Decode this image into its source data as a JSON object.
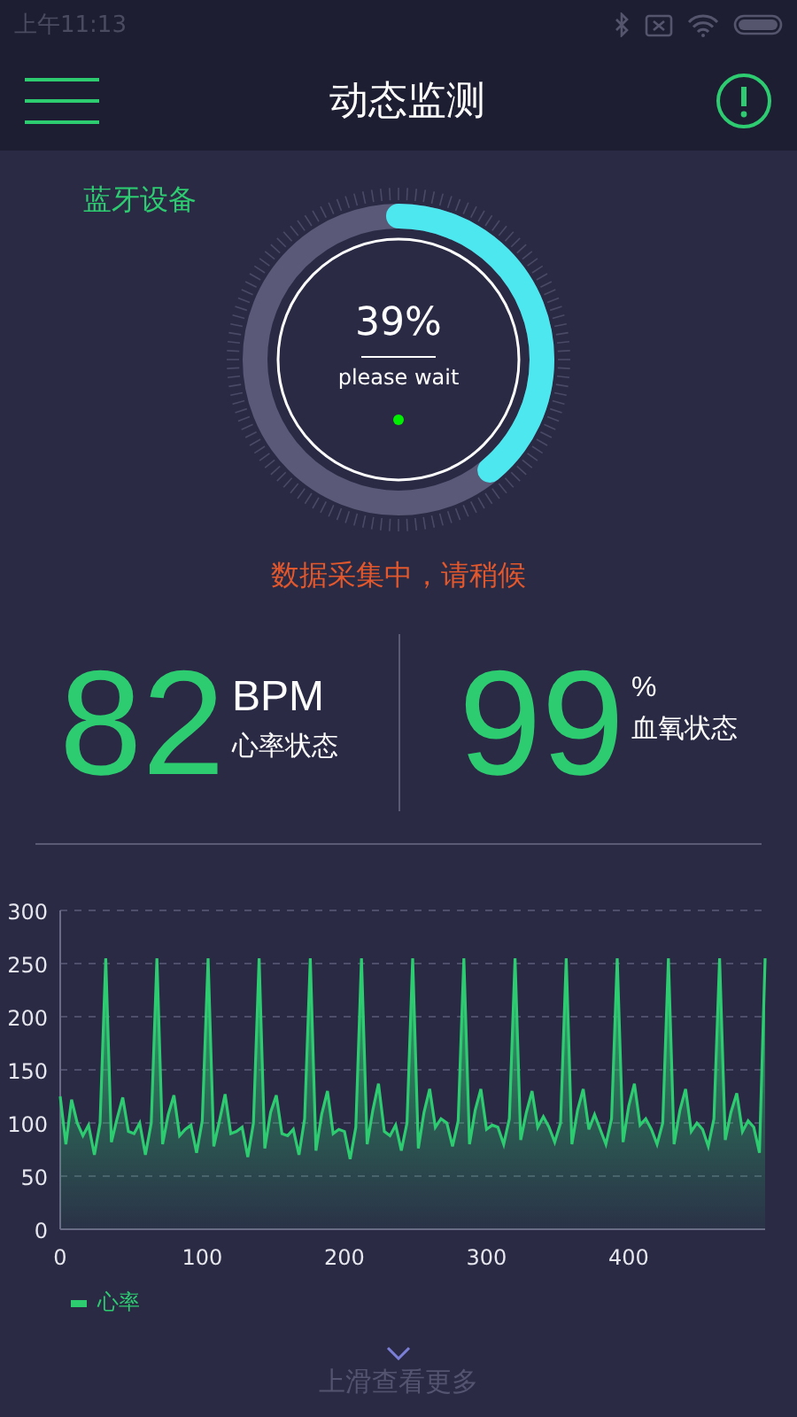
{
  "status_bar": {
    "time": "上午11:13"
  },
  "header": {
    "title": "动态监测"
  },
  "device_label": "蓝牙设备",
  "gauge": {
    "level": 0.39,
    "reading": "39%",
    "caption": "please wait"
  },
  "status_message": "数据采集中，请稍候",
  "metrics": [
    {
      "value": "82",
      "unit": "BPM",
      "label": "心率状态"
    },
    {
      "value": "99",
      "unit": "%",
      "label": "血氧状态"
    }
  ],
  "chart": {
    "chart_data": {
      "type": "area",
      "grid": true,
      "x": [
        0,
        4,
        8,
        12,
        16,
        20,
        24,
        28,
        32,
        36,
        40,
        44,
        48,
        52,
        56,
        60,
        64,
        68,
        72,
        76,
        80,
        84,
        88,
        92,
        96,
        100,
        104,
        108,
        112,
        116,
        120,
        124,
        128,
        132,
        136,
        140,
        144,
        148,
        152,
        156,
        160,
        164,
        168,
        172,
        176,
        180,
        184,
        188,
        192,
        196,
        200,
        204,
        208,
        212,
        216,
        220,
        224,
        228,
        232,
        236,
        240,
        244,
        248,
        252,
        256,
        260,
        264,
        268,
        272,
        276,
        280,
        284,
        288,
        292,
        296,
        300,
        304,
        308,
        312,
        316,
        320,
        324,
        328,
        332,
        336,
        340,
        344,
        348,
        352,
        356,
        360,
        364,
        368,
        372,
        376,
        380,
        384,
        388,
        392,
        396,
        400,
        404,
        408,
        412,
        416,
        420,
        424,
        428,
        432,
        436,
        440,
        444,
        448,
        452,
        456,
        460,
        464,
        468,
        472,
        476,
        480,
        484,
        488,
        492,
        496
      ],
      "xlim": [
        0,
        496
      ],
      "ylim": [
        0,
        300
      ],
      "xticks": [
        0,
        100,
        200,
        300,
        400
      ],
      "yticks": [
        0,
        50,
        100,
        150,
        200,
        250,
        300
      ],
      "series": [
        {
          "name": "心率",
          "color": "#2ecc71",
          "values": [
            125,
            80,
            122,
            100,
            88,
            98,
            70,
            100,
            255,
            82,
            104,
            124,
            92,
            90,
            100,
            70,
            100,
            255,
            80,
            108,
            126,
            88,
            94,
            98,
            72,
            102,
            255,
            78,
            102,
            127,
            90,
            92,
            96,
            68,
            100,
            255,
            76,
            110,
            126,
            90,
            88,
            94,
            70,
            104,
            255,
            74,
            108,
            130,
            90,
            94,
            92,
            66,
            96,
            255,
            80,
            112,
            137,
            92,
            88,
            98,
            74,
            100,
            255,
            76,
            110,
            132,
            96,
            104,
            100,
            78,
            102,
            255,
            80,
            112,
            132,
            94,
            98,
            96,
            80,
            104,
            255,
            84,
            110,
            130,
            96,
            106,
            96,
            82,
            100,
            255,
            80,
            112,
            132,
            94,
            108,
            94,
            80,
            104,
            255,
            82,
            116,
            137,
            98,
            104,
            94,
            80,
            100,
            255,
            80,
            112,
            132,
            92,
            100,
            94,
            78,
            104,
            255,
            84,
            110,
            128,
            92,
            102,
            96,
            72,
            255
          ]
        }
      ]
    }
  },
  "footer": {
    "hint": "上滑查看更多"
  }
}
